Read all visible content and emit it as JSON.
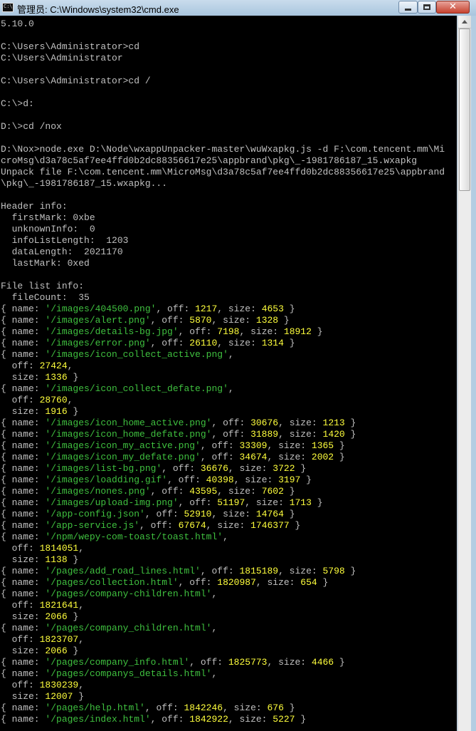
{
  "window": {
    "title": "管理员: C:\\Windows\\system32\\cmd.exe",
    "app_icon_text": "C:\\"
  },
  "console": {
    "lines": [
      [
        {
          "t": "5.10.0"
        }
      ],
      [],
      [
        {
          "t": "C:\\Users\\Administrator>cd"
        }
      ],
      [
        {
          "t": "C:\\Users\\Administrator"
        }
      ],
      [],
      [
        {
          "t": "C:\\Users\\Administrator>cd /"
        }
      ],
      [],
      [
        {
          "t": "C:\\>d:"
        }
      ],
      [],
      [
        {
          "t": "D:\\>cd /nox"
        }
      ],
      [],
      [
        {
          "t": "D:\\Nox>node.exe D:\\Node\\wxappUnpacker-master\\wuWxapkg.js -d F:\\com.tencent.mm\\Mi"
        }
      ],
      [
        {
          "t": "croMsg\\d3a78c5af7ee4ffd0b2dc88356617e25\\appbrand\\pkg\\_-1981786187_15.wxapkg"
        }
      ],
      [
        {
          "t": "Unpack file F:\\com.tencent.mm\\MicroMsg\\d3a78c5af7ee4ffd0b2dc88356617e25\\appbrand"
        }
      ],
      [
        {
          "t": "\\pkg\\_-1981786187_15.wxapkg..."
        }
      ],
      [],
      [
        {
          "t": "Header info:"
        }
      ],
      [
        {
          "t": "  firstMark: 0xbe"
        }
      ],
      [
        {
          "t": "  unknownInfo:  0"
        }
      ],
      [
        {
          "t": "  infoListLength:  1203"
        }
      ],
      [
        {
          "t": "  dataLength:  2021170"
        }
      ],
      [
        {
          "t": "  lastMark: 0xed"
        }
      ],
      [],
      [
        {
          "t": "File list info:"
        }
      ],
      [
        {
          "t": "  fileCount:  35"
        }
      ],
      [
        {
          "t": "{ name: "
        },
        {
          "t": "'/images/404500.png'",
          "c": "g"
        },
        {
          "t": ", off: "
        },
        {
          "t": "1217",
          "c": "y"
        },
        {
          "t": ", size: "
        },
        {
          "t": "4653",
          "c": "y"
        },
        {
          "t": " }"
        }
      ],
      [
        {
          "t": "{ name: "
        },
        {
          "t": "'/images/alert.png'",
          "c": "g"
        },
        {
          "t": ", off: "
        },
        {
          "t": "5870",
          "c": "y"
        },
        {
          "t": ", size: "
        },
        {
          "t": "1328",
          "c": "y"
        },
        {
          "t": " }"
        }
      ],
      [
        {
          "t": "{ name: "
        },
        {
          "t": "'/images/details-bg.jpg'",
          "c": "g"
        },
        {
          "t": ", off: "
        },
        {
          "t": "7198",
          "c": "y"
        },
        {
          "t": ", size: "
        },
        {
          "t": "18912",
          "c": "y"
        },
        {
          "t": " }"
        }
      ],
      [
        {
          "t": "{ name: "
        },
        {
          "t": "'/images/error.png'",
          "c": "g"
        },
        {
          "t": ", off: "
        },
        {
          "t": "26110",
          "c": "y"
        },
        {
          "t": ", size: "
        },
        {
          "t": "1314",
          "c": "y"
        },
        {
          "t": " }"
        }
      ],
      [
        {
          "t": "{ name: "
        },
        {
          "t": "'/images/icon_collect_active.png'",
          "c": "g"
        },
        {
          "t": ","
        }
      ],
      [
        {
          "t": "  off: "
        },
        {
          "t": "27424",
          "c": "y"
        },
        {
          "t": ","
        }
      ],
      [
        {
          "t": "  size: "
        },
        {
          "t": "1336",
          "c": "y"
        },
        {
          "t": " }"
        }
      ],
      [
        {
          "t": "{ name: "
        },
        {
          "t": "'/images/icon_collect_defate.png'",
          "c": "g"
        },
        {
          "t": ","
        }
      ],
      [
        {
          "t": "  off: "
        },
        {
          "t": "28760",
          "c": "y"
        },
        {
          "t": ","
        }
      ],
      [
        {
          "t": "  size: "
        },
        {
          "t": "1916",
          "c": "y"
        },
        {
          "t": " }"
        }
      ],
      [
        {
          "t": "{ name: "
        },
        {
          "t": "'/images/icon_home_active.png'",
          "c": "g"
        },
        {
          "t": ", off: "
        },
        {
          "t": "30676",
          "c": "y"
        },
        {
          "t": ", size: "
        },
        {
          "t": "1213",
          "c": "y"
        },
        {
          "t": " }"
        }
      ],
      [
        {
          "t": "{ name: "
        },
        {
          "t": "'/images/icon_home_defate.png'",
          "c": "g"
        },
        {
          "t": ", off: "
        },
        {
          "t": "31889",
          "c": "y"
        },
        {
          "t": ", size: "
        },
        {
          "t": "1420",
          "c": "y"
        },
        {
          "t": " }"
        }
      ],
      [
        {
          "t": "{ name: "
        },
        {
          "t": "'/images/icon_my_active.png'",
          "c": "g"
        },
        {
          "t": ", off: "
        },
        {
          "t": "33309",
          "c": "y"
        },
        {
          "t": ", size: "
        },
        {
          "t": "1365",
          "c": "y"
        },
        {
          "t": " }"
        }
      ],
      [
        {
          "t": "{ name: "
        },
        {
          "t": "'/images/icon_my_defate.png'",
          "c": "g"
        },
        {
          "t": ", off: "
        },
        {
          "t": "34674",
          "c": "y"
        },
        {
          "t": ", size: "
        },
        {
          "t": "2002",
          "c": "y"
        },
        {
          "t": " }"
        }
      ],
      [
        {
          "t": "{ name: "
        },
        {
          "t": "'/images/list-bg.png'",
          "c": "g"
        },
        {
          "t": ", off: "
        },
        {
          "t": "36676",
          "c": "y"
        },
        {
          "t": ", size: "
        },
        {
          "t": "3722",
          "c": "y"
        },
        {
          "t": " }"
        }
      ],
      [
        {
          "t": "{ name: "
        },
        {
          "t": "'/images/loadding.gif'",
          "c": "g"
        },
        {
          "t": ", off: "
        },
        {
          "t": "40398",
          "c": "y"
        },
        {
          "t": ", size: "
        },
        {
          "t": "3197",
          "c": "y"
        },
        {
          "t": " }"
        }
      ],
      [
        {
          "t": "{ name: "
        },
        {
          "t": "'/images/nones.png'",
          "c": "g"
        },
        {
          "t": ", off: "
        },
        {
          "t": "43595",
          "c": "y"
        },
        {
          "t": ", size: "
        },
        {
          "t": "7602",
          "c": "y"
        },
        {
          "t": " }"
        }
      ],
      [
        {
          "t": "{ name: "
        },
        {
          "t": "'/images/upload-img.png'",
          "c": "g"
        },
        {
          "t": ", off: "
        },
        {
          "t": "51197",
          "c": "y"
        },
        {
          "t": ", size: "
        },
        {
          "t": "1713",
          "c": "y"
        },
        {
          "t": " }"
        }
      ],
      [
        {
          "t": "{ name: "
        },
        {
          "t": "'/app-config.json'",
          "c": "g"
        },
        {
          "t": ", off: "
        },
        {
          "t": "52910",
          "c": "y"
        },
        {
          "t": ", size: "
        },
        {
          "t": "14764",
          "c": "y"
        },
        {
          "t": " }"
        }
      ],
      [
        {
          "t": "{ name: "
        },
        {
          "t": "'/app-service.js'",
          "c": "g"
        },
        {
          "t": ", off: "
        },
        {
          "t": "67674",
          "c": "y"
        },
        {
          "t": ", size: "
        },
        {
          "t": "1746377",
          "c": "y"
        },
        {
          "t": " }"
        }
      ],
      [
        {
          "t": "{ name: "
        },
        {
          "t": "'/npm/wepy-com-toast/toast.html'",
          "c": "g"
        },
        {
          "t": ","
        }
      ],
      [
        {
          "t": "  off: "
        },
        {
          "t": "1814051",
          "c": "y"
        },
        {
          "t": ","
        }
      ],
      [
        {
          "t": "  size: "
        },
        {
          "t": "1138",
          "c": "y"
        },
        {
          "t": " }"
        }
      ],
      [
        {
          "t": "{ name: "
        },
        {
          "t": "'/pages/add_road_lines.html'",
          "c": "g"
        },
        {
          "t": ", off: "
        },
        {
          "t": "1815189",
          "c": "y"
        },
        {
          "t": ", size: "
        },
        {
          "t": "5798",
          "c": "y"
        },
        {
          "t": " }"
        }
      ],
      [
        {
          "t": "{ name: "
        },
        {
          "t": "'/pages/collection.html'",
          "c": "g"
        },
        {
          "t": ", off: "
        },
        {
          "t": "1820987",
          "c": "y"
        },
        {
          "t": ", size: "
        },
        {
          "t": "654",
          "c": "y"
        },
        {
          "t": " }"
        }
      ],
      [
        {
          "t": "{ name: "
        },
        {
          "t": "'/pages/company-children.html'",
          "c": "g"
        },
        {
          "t": ","
        }
      ],
      [
        {
          "t": "  off: "
        },
        {
          "t": "1821641",
          "c": "y"
        },
        {
          "t": ","
        }
      ],
      [
        {
          "t": "  size: "
        },
        {
          "t": "2066",
          "c": "y"
        },
        {
          "t": " }"
        }
      ],
      [
        {
          "t": "{ name: "
        },
        {
          "t": "'/pages/company_children.html'",
          "c": "g"
        },
        {
          "t": ","
        }
      ],
      [
        {
          "t": "  off: "
        },
        {
          "t": "1823707",
          "c": "y"
        },
        {
          "t": ","
        }
      ],
      [
        {
          "t": "  size: "
        },
        {
          "t": "2066",
          "c": "y"
        },
        {
          "t": " }"
        }
      ],
      [
        {
          "t": "{ name: "
        },
        {
          "t": "'/pages/company_info.html'",
          "c": "g"
        },
        {
          "t": ", off: "
        },
        {
          "t": "1825773",
          "c": "y"
        },
        {
          "t": ", size: "
        },
        {
          "t": "4466",
          "c": "y"
        },
        {
          "t": " }"
        }
      ],
      [
        {
          "t": "{ name: "
        },
        {
          "t": "'/pages/companys_details.html'",
          "c": "g"
        },
        {
          "t": ","
        }
      ],
      [
        {
          "t": "  off: "
        },
        {
          "t": "1830239",
          "c": "y"
        },
        {
          "t": ","
        }
      ],
      [
        {
          "t": "  size: "
        },
        {
          "t": "12007",
          "c": "y"
        },
        {
          "t": " }"
        }
      ],
      [
        {
          "t": "{ name: "
        },
        {
          "t": "'/pages/help.html'",
          "c": "g"
        },
        {
          "t": ", off: "
        },
        {
          "t": "1842246",
          "c": "y"
        },
        {
          "t": ", size: "
        },
        {
          "t": "676",
          "c": "y"
        },
        {
          "t": " }"
        }
      ],
      [
        {
          "t": "{ name: "
        },
        {
          "t": "'/pages/index.html'",
          "c": "g"
        },
        {
          "t": ", off: "
        },
        {
          "t": "1842922",
          "c": "y"
        },
        {
          "t": ", size: "
        },
        {
          "t": "5227",
          "c": "y"
        },
        {
          "t": " }"
        }
      ]
    ]
  },
  "colors": {
    "console_bg": "#000000",
    "console_text": "#c0c0c0",
    "string_green": "#3fc03f",
    "number_yellow": "#ffff3c"
  }
}
